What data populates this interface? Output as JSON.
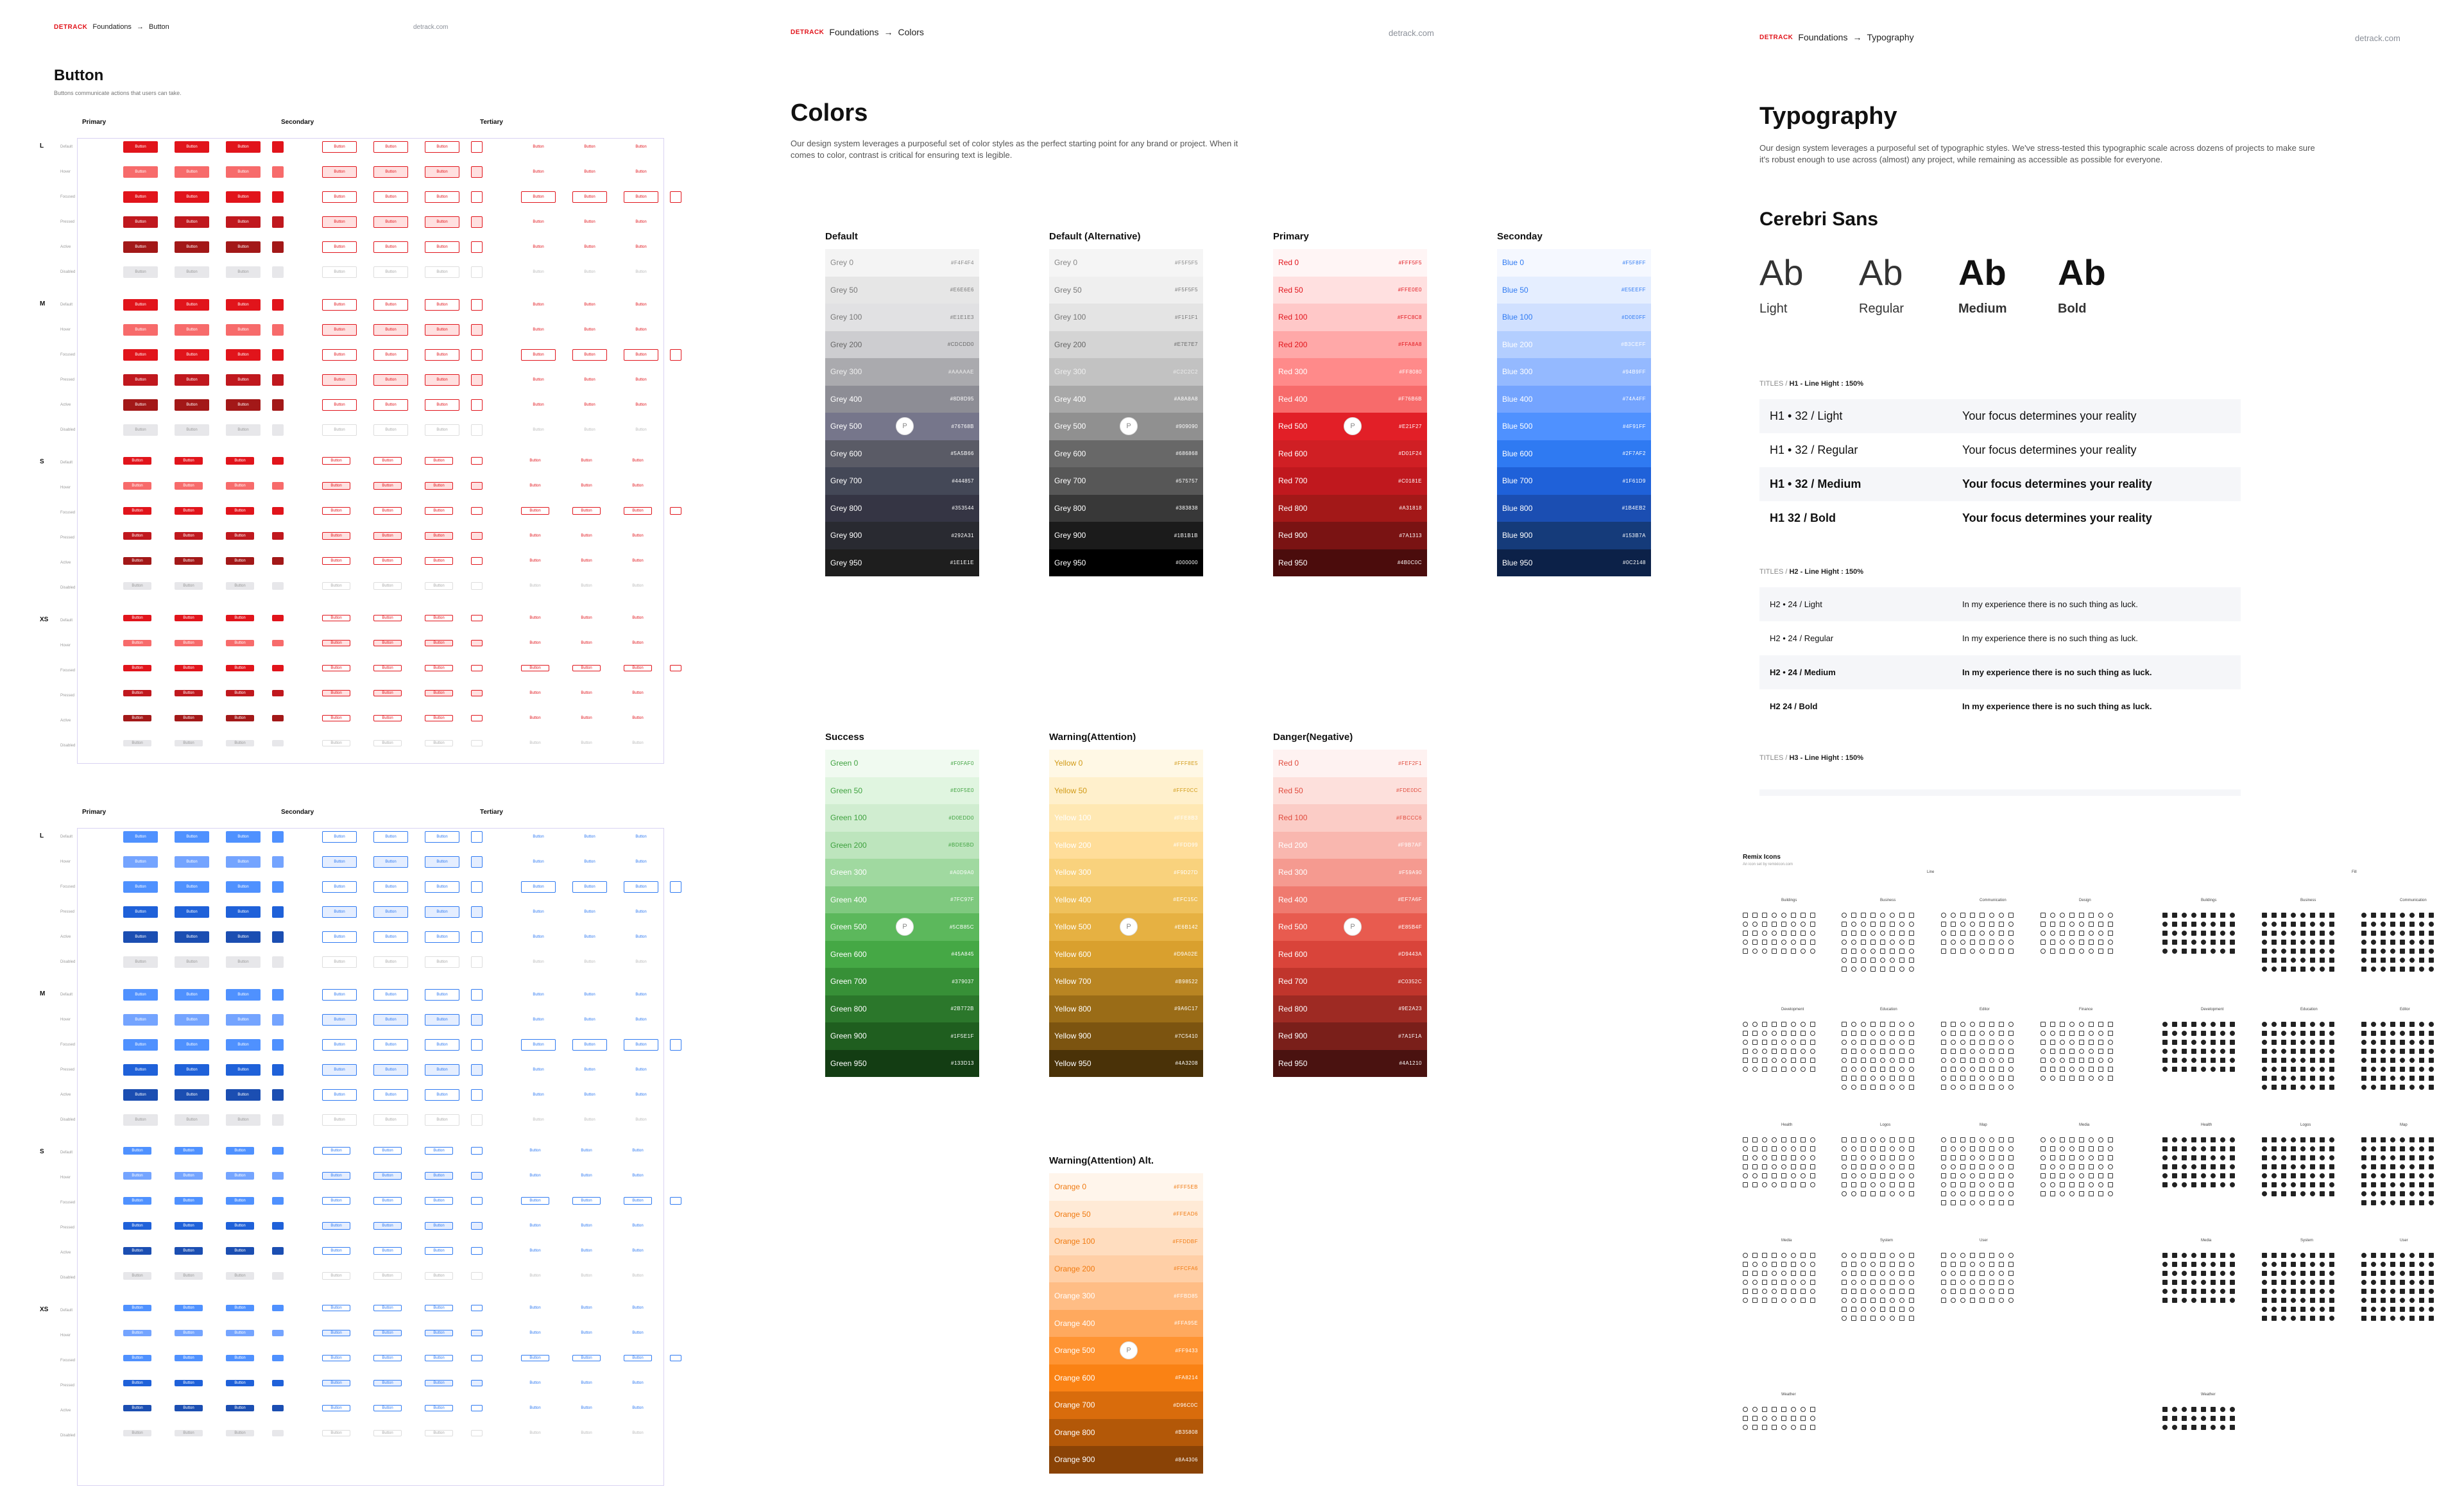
{
  "brand": {
    "logo": "DETRACK",
    "site": "detrack.com",
    "colors": {
      "red": "#e1141b",
      "blue": "#2f7af2"
    }
  },
  "button_page": {
    "breadcrumb": [
      "Foundations",
      "→",
      "Button"
    ],
    "title": "Button",
    "description": "Buttons communicate actions that users can take.",
    "groups": [
      "Primary",
      "Secondary",
      "Tertiary"
    ],
    "sizes": [
      "L",
      "M",
      "S",
      "XS"
    ],
    "states": [
      "Default",
      "Hover",
      "Focused",
      "Pressed",
      "Active",
      "Disabled"
    ],
    "label": "Button"
  },
  "colors_page": {
    "breadcrumb": [
      "Foundations",
      "→",
      "Colors"
    ],
    "title": "Colors",
    "description": "Our design system leverages a purposeful set of color styles as the perfect starting point for any brand or project. When it comes to color, contrast is critical for ensuring text is legible.",
    "palettes": [
      {
        "title": "Default",
        "pin": "P",
        "swatches": [
          {
            "name": "Grey 0",
            "hex": "#F4F4F4",
            "bg": "#f4f4f4",
            "fg": "#888"
          },
          {
            "name": "Grey 50",
            "hex": "#E6E6E6",
            "bg": "#e6e6e6",
            "fg": "#777"
          },
          {
            "name": "Grey 100",
            "hex": "#E1E1E3",
            "bg": "#e1e1e3",
            "fg": "#777"
          },
          {
            "name": "Grey 200",
            "hex": "#CDCDD0",
            "bg": "#cdcdd0",
            "fg": "#666"
          },
          {
            "name": "Grey 300",
            "hex": "#AAAAAE",
            "bg": "#aaaaae",
            "fg": "#eee"
          },
          {
            "name": "Grey 400",
            "hex": "#8D8D95",
            "bg": "#8d8d95",
            "fg": "#fff"
          },
          {
            "name": "Grey 500",
            "hex": "#76768B",
            "bg": "#76768b",
            "fg": "#fff"
          },
          {
            "name": "Grey 600",
            "hex": "#5A5B66",
            "bg": "#5a5b66",
            "fg": "#fff"
          },
          {
            "name": "Grey 700",
            "hex": "#444857",
            "bg": "#444857",
            "fg": "#fff"
          },
          {
            "name": "Grey 800",
            "hex": "#353544",
            "bg": "#353544",
            "fg": "#fff"
          },
          {
            "name": "Grey 900",
            "hex": "#292A31",
            "bg": "#292a31",
            "fg": "#fff"
          },
          {
            "name": "Grey 950",
            "hex": "#1E1E1E",
            "bg": "#1e1e1e",
            "fg": "#fff"
          }
        ]
      },
      {
        "title": "Default (Alternative)",
        "pin": "P",
        "swatches": [
          {
            "name": "Grey 0",
            "hex": "#F5F5F5",
            "bg": "#f5f5f5",
            "fg": "#888"
          },
          {
            "name": "Grey 50",
            "hex": "#F5F5F5",
            "bg": "#efefef",
            "fg": "#777"
          },
          {
            "name": "Grey 100",
            "hex": "#F1F1F1",
            "bg": "#e4e4e4",
            "fg": "#777"
          },
          {
            "name": "Grey 200",
            "hex": "#E7E7E7",
            "bg": "#d4d4d4",
            "fg": "#666"
          },
          {
            "name": "Grey 300",
            "hex": "#C2C2C2",
            "bg": "#c2c2c2",
            "fg": "#eee"
          },
          {
            "name": "Grey 400",
            "hex": "#A8A8A8",
            "bg": "#a8a8a8",
            "fg": "#fff"
          },
          {
            "name": "Grey 500",
            "hex": "#909090",
            "bg": "#909090",
            "fg": "#fff"
          },
          {
            "name": "Grey 600",
            "hex": "#686868",
            "bg": "#686868",
            "fg": "#fff"
          },
          {
            "name": "Grey 700",
            "hex": "#575757",
            "bg": "#575757",
            "fg": "#fff"
          },
          {
            "name": "Grey 800",
            "hex": "#383838",
            "bg": "#383838",
            "fg": "#fff"
          },
          {
            "name": "Grey 900",
            "hex": "#1B1B1B",
            "bg": "#1b1b1b",
            "fg": "#fff"
          },
          {
            "name": "Grey 950",
            "hex": "#000000",
            "bg": "#000000",
            "fg": "#fff"
          }
        ]
      },
      {
        "title": "Primary",
        "pin": "P",
        "swatches": [
          {
            "name": "Red 0",
            "hex": "#FFF5F5",
            "bg": "#fff5f5",
            "fg": "#e1141b"
          },
          {
            "name": "Red 50",
            "hex": "#FFE0E0",
            "bg": "#ffe0e0",
            "fg": "#e1141b"
          },
          {
            "name": "Red 100",
            "hex": "#FFC8C8",
            "bg": "#ffc8c8",
            "fg": "#e1141b"
          },
          {
            "name": "Red 200",
            "hex": "#FFA8A8",
            "bg": "#ffa8a8",
            "fg": "#e1141b"
          },
          {
            "name": "Red 300",
            "hex": "#FF8080",
            "bg": "#ff8a8a",
            "fg": "#fff"
          },
          {
            "name": "Red 400",
            "hex": "#F76B6B",
            "bg": "#f76b6b",
            "fg": "#fff"
          },
          {
            "name": "Red 500",
            "hex": "#E21F27",
            "bg": "#e21f27",
            "fg": "#fff"
          },
          {
            "name": "Red 600",
            "hex": "#D01F24",
            "bg": "#d01f24",
            "fg": "#fff"
          },
          {
            "name": "Red 700",
            "hex": "#C0181E",
            "bg": "#c0181e",
            "fg": "#fff"
          },
          {
            "name": "Red 800",
            "hex": "#A31818",
            "bg": "#a31818",
            "fg": "#fff"
          },
          {
            "name": "Red 900",
            "hex": "#7A1313",
            "bg": "#7a1313",
            "fg": "#fff"
          },
          {
            "name": "Red 950",
            "hex": "#4B0C0C",
            "bg": "#4b0c0c",
            "fg": "#fff"
          }
        ]
      },
      {
        "title": "Seconday",
        "pin": "",
        "swatches": [
          {
            "name": "Blue 0",
            "hex": "#F5F8FF",
            "bg": "#f5f8ff",
            "fg": "#2f7af2"
          },
          {
            "name": "Blue 50",
            "hex": "#E5EEFF",
            "bg": "#e5eeff",
            "fg": "#2f7af2"
          },
          {
            "name": "Blue 100",
            "hex": "#D0E0FF",
            "bg": "#d0e0ff",
            "fg": "#2f7af2"
          },
          {
            "name": "Blue 200",
            "hex": "#B3CEFF",
            "bg": "#b3ceff",
            "fg": "#fff"
          },
          {
            "name": "Blue 300",
            "hex": "#94B9FF",
            "bg": "#94b9ff",
            "fg": "#fff"
          },
          {
            "name": "Blue 400",
            "hex": "#74A4FF",
            "bg": "#74a4ff",
            "fg": "#fff"
          },
          {
            "name": "Blue 500",
            "hex": "#4F91FF",
            "bg": "#4f91ff",
            "fg": "#fff"
          },
          {
            "name": "Blue 600",
            "hex": "#2F7AF2",
            "bg": "#2f7af2",
            "fg": "#fff"
          },
          {
            "name": "Blue 700",
            "hex": "#1F61D9",
            "bg": "#1f61d9",
            "fg": "#fff"
          },
          {
            "name": "Blue 800",
            "hex": "#1B4EB2",
            "bg": "#1b4eb2",
            "fg": "#fff"
          },
          {
            "name": "Blue 900",
            "hex": "#153B7A",
            "bg": "#153b7a",
            "fg": "#fff"
          },
          {
            "name": "Blue 950",
            "hex": "#0C2148",
            "bg": "#0c2148",
            "fg": "#fff"
          }
        ]
      },
      {
        "title": "Success",
        "pin": "P",
        "swatches": [
          {
            "name": "Green 0",
            "hex": "#F0FAF0",
            "bg": "#f0faf0",
            "fg": "#3ea13e"
          },
          {
            "name": "Green 50",
            "hex": "#E0F5E0",
            "bg": "#e0f5e0",
            "fg": "#3ea13e"
          },
          {
            "name": "Green 100",
            "hex": "#D0EDD0",
            "bg": "#d0edd0",
            "fg": "#3ea13e"
          },
          {
            "name": "Green 200",
            "hex": "#BDE5BD",
            "bg": "#bde5bd",
            "fg": "#3ea13e"
          },
          {
            "name": "Green 300",
            "hex": "#A0D9A0",
            "bg": "#a0d9a0",
            "fg": "#fff"
          },
          {
            "name": "Green 400",
            "hex": "#7FC97F",
            "bg": "#7fc97f",
            "fg": "#fff"
          },
          {
            "name": "Green 500",
            "hex": "#5CB85C",
            "bg": "#5cb85c",
            "fg": "#fff"
          },
          {
            "name": "Green 600",
            "hex": "#45A845",
            "bg": "#45a845",
            "fg": "#fff"
          },
          {
            "name": "Green 700",
            "hex": "#379037",
            "bg": "#379037",
            "fg": "#fff"
          },
          {
            "name": "Green 800",
            "hex": "#2B772B",
            "bg": "#2b772b",
            "fg": "#fff"
          },
          {
            "name": "Green 900",
            "hex": "#1F5E1F",
            "bg": "#1f5e1f",
            "fg": "#fff"
          },
          {
            "name": "Green 950",
            "hex": "#133D13",
            "bg": "#133d13",
            "fg": "#fff"
          }
        ]
      },
      {
        "title": "Warning(Attention)",
        "pin": "P",
        "swatches": [
          {
            "name": "Yellow 0",
            "hex": "#FFF8E5",
            "bg": "#fff8e5",
            "fg": "#d19a16"
          },
          {
            "name": "Yellow 50",
            "hex": "#FFF0CC",
            "bg": "#fff0cc",
            "fg": "#d19a16"
          },
          {
            "name": "Yellow 100",
            "hex": "#FFE8B3",
            "bg": "#ffe8b3",
            "fg": "#fff"
          },
          {
            "name": "Yellow 200",
            "hex": "#FFDD99",
            "bg": "#ffdd99",
            "fg": "#fff"
          },
          {
            "name": "Yellow 300",
            "hex": "#F9D27D",
            "bg": "#f9d27d",
            "fg": "#fff"
          },
          {
            "name": "Yellow 400",
            "hex": "#EFC15C",
            "bg": "#efc15c",
            "fg": "#fff"
          },
          {
            "name": "Yellow 500",
            "hex": "#E6B142",
            "bg": "#e6b142",
            "fg": "#fff"
          },
          {
            "name": "Yellow 600",
            "hex": "#D9A02E",
            "bg": "#d9a02e",
            "fg": "#fff"
          },
          {
            "name": "Yellow 700",
            "hex": "#B98522",
            "bg": "#b98522",
            "fg": "#fff"
          },
          {
            "name": "Yellow 800",
            "hex": "#9A6C17",
            "bg": "#9a6c17",
            "fg": "#fff"
          },
          {
            "name": "Yellow 900",
            "hex": "#7C5410",
            "bg": "#7c5410",
            "fg": "#fff"
          },
          {
            "name": "Yellow 950",
            "hex": "#4A3208",
            "bg": "#4a3208",
            "fg": "#fff"
          }
        ]
      },
      {
        "title": "Danger(Negative)",
        "pin": "P",
        "swatches": [
          {
            "name": "Red 0",
            "hex": "#FEF2F1",
            "bg": "#fef2f1",
            "fg": "#e04a3c"
          },
          {
            "name": "Red 50",
            "hex": "#FDE0DC",
            "bg": "#fde0dc",
            "fg": "#e04a3c"
          },
          {
            "name": "Red 100",
            "hex": "#FBCCC6",
            "bg": "#fbccc6",
            "fg": "#e04a3c"
          },
          {
            "name": "Red 200",
            "hex": "#F9B7AF",
            "bg": "#f9b7af",
            "fg": "#fff"
          },
          {
            "name": "Red 300",
            "hex": "#F59A90",
            "bg": "#f59a90",
            "fg": "#fff"
          },
          {
            "name": "Red 400",
            "hex": "#EF7A6F",
            "bg": "#ef7a6f",
            "fg": "#fff"
          },
          {
            "name": "Red 500",
            "hex": "#E85B4F",
            "bg": "#e85b4f",
            "fg": "#fff"
          },
          {
            "name": "Red 600",
            "hex": "#D9443A",
            "bg": "#d9443a",
            "fg": "#fff"
          },
          {
            "name": "Red 700",
            "hex": "#C0352C",
            "bg": "#c0352c",
            "fg": "#fff"
          },
          {
            "name": "Red 800",
            "hex": "#9E2A23",
            "bg": "#9e2a23",
            "fg": "#fff"
          },
          {
            "name": "Red 900",
            "hex": "#7A1F1A",
            "bg": "#7a1f1a",
            "fg": "#fff"
          },
          {
            "name": "Red 950",
            "hex": "#4A1210",
            "bg": "#4a1210",
            "fg": "#fff"
          }
        ]
      },
      {
        "title": "Warning(Attention) Alt.",
        "pin": "P",
        "swatches": [
          {
            "name": "Orange 0",
            "hex": "#FFF5EB",
            "bg": "#fff5eb",
            "fg": "#f07a10"
          },
          {
            "name": "Orange 50",
            "hex": "#FFEAD6",
            "bg": "#ffead6",
            "fg": "#f07a10"
          },
          {
            "name": "Orange 100",
            "hex": "#FFDDBF",
            "bg": "#ffddbf",
            "fg": "#f07a10"
          },
          {
            "name": "Orange 200",
            "hex": "#FFCFA6",
            "bg": "#ffcfa6",
            "fg": "#f07a10"
          },
          {
            "name": "Orange 300",
            "hex": "#FFBD85",
            "bg": "#ffbd85",
            "fg": "#fff"
          },
          {
            "name": "Orange 400",
            "hex": "#FFA95E",
            "bg": "#ffa95e",
            "fg": "#fff"
          },
          {
            "name": "Orange 500",
            "hex": "#FF9433",
            "bg": "#ff9433",
            "fg": "#fff"
          },
          {
            "name": "Orange 600",
            "hex": "#FA8214",
            "bg": "#fa8214",
            "fg": "#fff"
          },
          {
            "name": "Orange 700",
            "hex": "#D96C0C",
            "bg": "#d96c0c",
            "fg": "#fff"
          },
          {
            "name": "Orange 800",
            "hex": "#B35808",
            "bg": "#b35808",
            "fg": "#fff"
          },
          {
            "name": "Orange 900",
            "hex": "#8A4306",
            "bg": "#8a4306",
            "fg": "#fff"
          }
        ]
      }
    ]
  },
  "typography_page": {
    "breadcrumb": [
      "Foundations",
      "→",
      "Typography"
    ],
    "title": "Typography",
    "description": "Our design system leverages a purposeful set of typographic styles. We've stress-tested this typographic scale across dozens of projects to make sure it's robust enough to use across (almost) any project, while remaining as accessible as possible for everyone.",
    "font_name": "Cerebri Sans",
    "weights": [
      {
        "sample": "Ab",
        "label": "Light"
      },
      {
        "sample": "Ab",
        "label": "Regular"
      },
      {
        "sample": "Ab",
        "label": "Medium"
      },
      {
        "sample": "Ab",
        "label": "Bold"
      }
    ],
    "h1_section": {
      "prefix": "TITLES /",
      "title": "H1 - Line Hight : 150%"
    },
    "h1_rows": [
      {
        "label": "H1 • 32 / Light",
        "sample": "Your focus determines your reality"
      },
      {
        "label": "H1 • 32 / Regular",
        "sample": "Your focus determines your reality"
      },
      {
        "label": "H1 • 32 / Medium",
        "sample": "Your focus determines your reality"
      },
      {
        "label": "H1     32 / Bold",
        "sample": "Your focus determines your reality"
      }
    ],
    "h2_section": {
      "prefix": "TITLES /",
      "title": "H2 - Line Hight : 150%"
    },
    "h2_rows": [
      {
        "label": "H2 • 24 / Light",
        "sample": "In my experience there is no such thing as luck."
      },
      {
        "label": "H2 • 24 / Regular",
        "sample": "In my experience there is no such thing as luck."
      },
      {
        "label": "H2 • 24 / Medium",
        "sample": "In my experience there is no such thing as luck."
      },
      {
        "label": "H2     24 / Bold",
        "sample": "In my experience there is no such thing as luck."
      }
    ],
    "h3_section": {
      "prefix": "TITLES /",
      "title": "H3 - Line Hight : 150%"
    }
  },
  "icons_page": {
    "title": "Remix Icons",
    "subtitle": "An icon set by remixicon.com",
    "styles": [
      "Line",
      "Fill"
    ],
    "categories": [
      "Buildings",
      "Business",
      "Communication",
      "Design",
      "Development",
      "Education",
      "Editor",
      "Finance",
      "Health",
      "Logos",
      "Map",
      "Media",
      "System",
      "User",
      "Weather",
      "Document"
    ]
  }
}
